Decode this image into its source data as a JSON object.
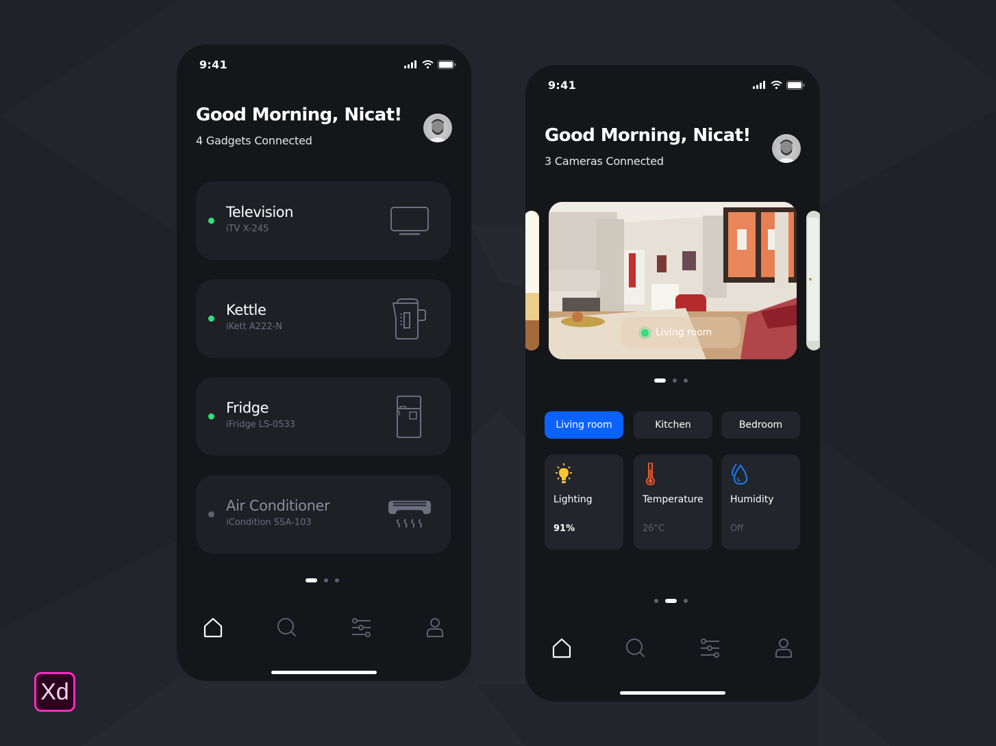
{
  "background_color": "#22252c",
  "accent_color": "#0a62ff",
  "online_color": "#2ee07a",
  "offline_color": "#5c6070",
  "badge": {
    "label": "Xd",
    "icon": "adobe-xd-logo"
  },
  "screens": [
    {
      "status_bar": {
        "time": "9:41",
        "icons": [
          "signal-icon",
          "wifi-icon",
          "battery-icon"
        ]
      },
      "header": {
        "greeting": "Good Morning, Nicat!",
        "subtitle": "4 Gadgets Connected",
        "avatar": "user-avatar"
      },
      "devices": [
        {
          "name": "Television",
          "model": "iTV X-245",
          "status": "online",
          "icon": "television-icon"
        },
        {
          "name": "Kettle",
          "model": "iKett A222-N",
          "status": "online",
          "icon": "kettle-icon"
        },
        {
          "name": "Fridge",
          "model": "iFridge LS-0533",
          "status": "online",
          "icon": "fridge-icon"
        },
        {
          "name": "Air Conditioner",
          "model": "iCondition SSA-103",
          "status": "offline",
          "icon": "air-conditioner-icon"
        }
      ],
      "pager": {
        "pages": 3,
        "active_index": 0
      },
      "tabbar": [
        {
          "icon": "home-icon",
          "active": true
        },
        {
          "icon": "search-icon",
          "active": false
        },
        {
          "icon": "sliders-icon",
          "active": false
        },
        {
          "icon": "profile-icon",
          "active": false
        }
      ]
    },
    {
      "status_bar": {
        "time": "9:41",
        "icons": [
          "signal-icon",
          "wifi-icon",
          "battery-icon"
        ]
      },
      "header": {
        "greeting": "Good Morning, Nicat!",
        "subtitle": "3 Cameras Connected",
        "avatar": "user-avatar"
      },
      "camera": {
        "label": "Living room",
        "status": "live"
      },
      "camera_pager": {
        "pages": 3,
        "active_index": 0
      },
      "rooms": [
        {
          "label": "Living room",
          "active": true
        },
        {
          "label": "Kitchen",
          "active": false
        },
        {
          "label": "Bedroom",
          "active": false
        }
      ],
      "stats": [
        {
          "label": "Lighting",
          "value": "91%",
          "on": true,
          "icon": "lightbulb-icon",
          "color": "#f7c531"
        },
        {
          "label": "Temperature",
          "value": "26°C",
          "on": false,
          "icon": "thermometer-icon",
          "color": "#e8582a"
        },
        {
          "label": "Humidity",
          "value": "Off",
          "on": false,
          "icon": "water-drop-icon",
          "color": "#1a7cf0"
        }
      ],
      "pager": {
        "pages": 3,
        "active_index": 1
      },
      "tabbar": [
        {
          "icon": "home-icon",
          "active": true
        },
        {
          "icon": "search-icon",
          "active": false
        },
        {
          "icon": "sliders-icon",
          "active": false
        },
        {
          "icon": "profile-icon",
          "active": false
        }
      ]
    }
  ]
}
